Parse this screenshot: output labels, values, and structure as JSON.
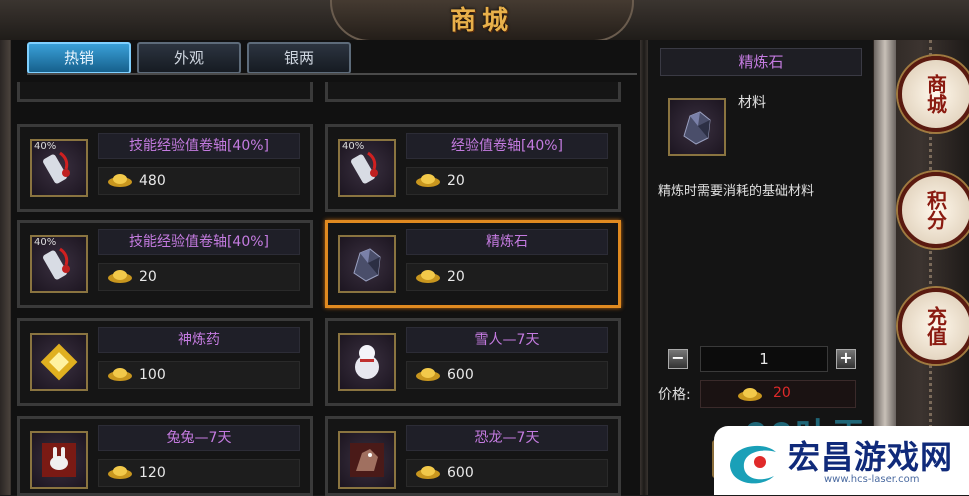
{
  "window": {
    "title": "商城"
  },
  "tabs": [
    {
      "label": "热销",
      "active": true
    },
    {
      "label": "外观",
      "active": false
    },
    {
      "label": "银两",
      "active": false
    }
  ],
  "items": [
    {
      "name": "技能经验值卷轴[40%]",
      "price": "480",
      "badge": "40%",
      "icon": "scroll-icon"
    },
    {
      "name": "经验值卷轴[40%]",
      "price": "20",
      "badge": "40%",
      "icon": "scroll-icon"
    },
    {
      "name": "技能经验值卷轴[40%]",
      "price": "20",
      "badge": "40%",
      "icon": "scroll-icon"
    },
    {
      "name": "精炼石",
      "price": "20",
      "badge": "",
      "icon": "ore-icon",
      "selected": true
    },
    {
      "name": "神炼药",
      "price": "100",
      "badge": "",
      "icon": "potion-icon"
    },
    {
      "name": "雪人—7天",
      "price": "600",
      "badge": "",
      "icon": "snowman-icon"
    },
    {
      "name": "兔兔—7天",
      "price": "120",
      "badge": "",
      "icon": "rabbit-icon"
    },
    {
      "name": "恐龙—7天",
      "price": "600",
      "badge": "",
      "icon": "dino-icon"
    }
  ],
  "detail": {
    "title": "精炼石",
    "type": "材料",
    "description": "精炼时需要消耗的基础材料",
    "quantity": "1",
    "price_label": "价格:",
    "price": "20",
    "minus": "−",
    "plus": "+"
  },
  "side_buttons": [
    "商城",
    "积分",
    "充值"
  ],
  "watermark": {
    "text": "宏昌游戏网",
    "url": "www.hcs-laser.com",
    "overlay": "00叶于"
  },
  "colors": {
    "accent": "#e08a20",
    "item_name": "#c47be0",
    "price_red": "#e02a2a",
    "tab_active": "#3aa0d8"
  }
}
